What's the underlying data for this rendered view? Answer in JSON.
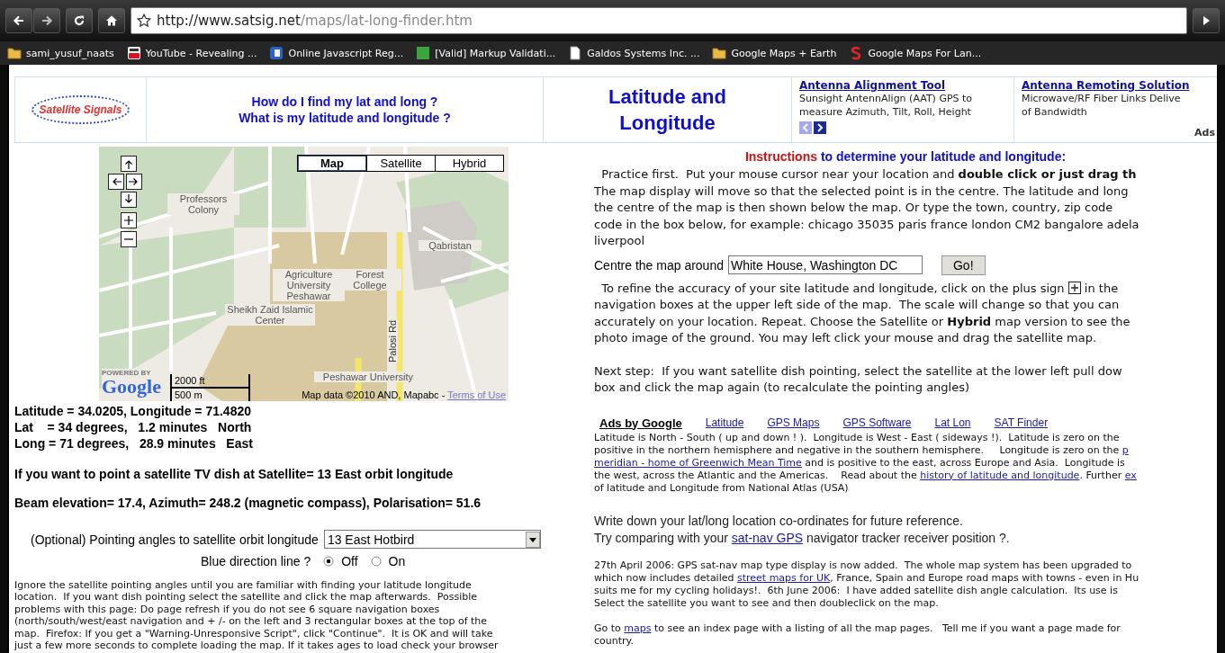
{
  "browser": {
    "url": {
      "host": "http://www.satsig.net",
      "path": "/maps/lat-long-finder.htm"
    },
    "bookmarks": [
      {
        "label": "sami_yusuf_naats"
      },
      {
        "label": "YouTube - Revealing ..."
      },
      {
        "label": "Online Javascript Reg..."
      },
      {
        "label": "[Valid] Markup Validati..."
      },
      {
        "label": "Galdos Systems Inc. ..."
      },
      {
        "label": "Google Maps + Earth"
      },
      {
        "label": "Google Maps For Lan..."
      }
    ]
  },
  "header": {
    "logo": "Satellite Signals",
    "questions": [
      "How do I find my lat and long ?",
      "What is my latitude and longitude ?"
    ],
    "title": [
      "Latitude and",
      "Longitude"
    ],
    "ads": [
      {
        "title": "Antenna Alignment Tool",
        "lines": [
          "Sunsight AntennAlign (AAT) GPS to",
          "measure Azimuth, Tilt, Roll, Height"
        ]
      },
      {
        "title": "Antenna Remoting Solution",
        "lines": [
          "Microwave/RF Fiber Links Delive",
          "of Bandwidth"
        ]
      }
    ],
    "ads_label": "Ads"
  },
  "map": {
    "modes": [
      {
        "label": "Map",
        "selected": true
      },
      {
        "label": "Satellite",
        "selected": false
      },
      {
        "label": "Hybrid",
        "selected": false
      }
    ],
    "labels": [
      "Professors Colony",
      "Qabristan",
      "Agriculture University Peshawar",
      "Forest College",
      "Sheikh Zaid Islamic Center",
      "Palosi Rd",
      "Peshawar University"
    ],
    "powered_by": "POWERED BY",
    "google": "Google",
    "scale": [
      "2000 ft",
      "500 m"
    ],
    "attribution": "Map data ©2010 AND, Mapabc - ",
    "terms": "Terms of Use"
  },
  "coords": [
    "Latitude = 34.0205, Longitude = 71.4820",
    "Lat    = 34 degrees,   1.2 minutes   North",
    "Long = 71 degrees,   28.9 minutes   East"
  ],
  "dish_line": "If you want to point a satellite TV dish at Satellite= 13 East orbit longitude",
  "beam_line": "Beam elevation= 17.4, Azimuth= 248.2 (magnetic compass), Polarisation= 51.6",
  "pointing": {
    "label": "(Optional) Pointing angles to satellite orbit longitude",
    "value": "13 East Hotbird"
  },
  "direction": {
    "label": "Blue direction line ?",
    "options": [
      {
        "label": "Off",
        "selected": true
      },
      {
        "label": "On",
        "selected": false
      }
    ]
  },
  "left_note": [
    "Ignore the satellite pointing angles until you are familiar with finding your latitude longitude",
    "location.  If you want dish pointing select the satellite and click the map afterwards.  Possible",
    "problems with this page: Do page refresh if you do not see 6 square navigation boxes",
    "(north/south/west/east navigation and + /- on the left and 3 rectangular boxes at the top of the",
    "map.  Firefox: If you get a \"Warning-Unresponsive Script\", click \"Continue\".  It is OK and will take",
    "just a few more seconds to complete loading the map. If it takes ages to load check your browser"
  ],
  "instructions": {
    "title": "Instructions",
    "title_rest": " to determine your latitude and longitude:",
    "intro": [
      [
        {
          "kind": "text",
          "text": "  Practice first.  Put your mouse cursor near your location and **double click or just drag th**"
        }
      ],
      [
        {
          "kind": "text",
          "text": "The map display will move so that the selected point is in the centre. The latitude and long"
        }
      ],
      [
        {
          "kind": "text",
          "text": "the centre of the map is then shown below the map. Or type the town, country, zip code"
        }
      ],
      [
        {
          "kind": "text",
          "text": "code in the box below, for example: chicago 35035 paris france london CM2 bangalore adela"
        }
      ],
      [
        {
          "kind": "text",
          "text": "liverpool"
        }
      ]
    ],
    "centre_label": "Centre the map around",
    "centre_value": "White House, Washington DC",
    "go": "Go!",
    "refine": [
      [
        {
          "kind": "text",
          "text": "  To refine the accuracy of your site latitude and longitude, click on the plus sign "
        },
        {
          "kind": "icon"
        },
        {
          "kind": "text",
          "text": " in the"
        }
      ],
      [
        {
          "kind": "text",
          "text": "navigation boxes at the upper left side of the map.  The scale will change so that you can"
        }
      ],
      [
        {
          "kind": "text",
          "text": "accurately on your location. Repeat. Choose the Satellite or **Hybrid** map version to see the"
        }
      ],
      [
        {
          "kind": "text",
          "text": "photo image of the ground. You may left click your mouse and drag the satellite map."
        }
      ]
    ],
    "next": [
      [
        {
          "kind": "text",
          "text": "Next step:  If you want satellite dish pointing, select the satellite at the lower left pull dow"
        }
      ],
      [
        {
          "kind": "text",
          "text": "box and click the map again (to recalculate the pointing angles)"
        }
      ]
    ]
  },
  "ads_by": "Ads by Google",
  "ad_links": [
    "Latitude",
    "GPS Maps",
    "GPS Software",
    "Lat Lon",
    "SAT Finder"
  ],
  "info": [
    [
      {
        "kind": "text",
        "text": "Latitude is North - South ( up and down ! ).  Longitude is West - East ( sideways !).  Latitude is zero on the"
      }
    ],
    [
      {
        "kind": "text",
        "text": "positive in the northern hemisphere and negative in the southern hemisphere.     Longitude is zero on the "
      },
      {
        "kind": "link",
        "text": "p"
      }
    ],
    [
      {
        "kind": "link",
        "text": "meridian - home of Greenwich Mean Time"
      },
      {
        "kind": "text",
        "text": " and is positive to the east, across Europe and Asia.  Longitude is"
      }
    ],
    [
      {
        "kind": "text",
        "text": "the west, across the Atlantic and the Americas.    Read about the "
      },
      {
        "kind": "link",
        "text": "history of latitude and longitude"
      },
      {
        "kind": "text",
        "text": ". Further "
      },
      {
        "kind": "link",
        "text": "ex"
      }
    ],
    [
      {
        "kind": "text",
        "text": "of latitude and Longitude from National Atlas (USA)"
      }
    ]
  ],
  "write_down": [
    [
      {
        "kind": "text",
        "text": "Write down your lat/long location co-ordinates for future reference."
      }
    ],
    [
      {
        "kind": "text",
        "text": "Try comparing with your "
      },
      {
        "kind": "link",
        "text": "sat-nav GPS"
      },
      {
        "kind": "text",
        "text": " navigator tracker receiver position ?."
      }
    ]
  ],
  "news": [
    [
      {
        "kind": "text",
        "text": "27th April 2006: GPS sat-nav map type display is now added.  The whole map system has been upgraded to"
      }
    ],
    [
      {
        "kind": "text",
        "text": "which now includes detailed "
      },
      {
        "kind": "link",
        "text": "street maps for UK"
      },
      {
        "kind": "text",
        "text": ", France, Spain and Europe road maps with towns - even in Hu"
      }
    ],
    [
      {
        "kind": "text",
        "text": "suits me for my cycling holidays!.  6th June 2006:  I have added satellite dish angle calculation.  Its use is"
      }
    ],
    [
      {
        "kind": "text",
        "text": "Select the satellite you want to see and then doubleclick on the map."
      }
    ]
  ],
  "goto": [
    [
      {
        "kind": "text",
        "text": "Go to "
      },
      {
        "kind": "link",
        "text": "maps"
      },
      {
        "kind": "text",
        "text": " to see an index page with a listing of all the map pages.   Tell me if you want a page made for"
      }
    ],
    [
      {
        "kind": "text",
        "text": "country."
      }
    ]
  ]
}
